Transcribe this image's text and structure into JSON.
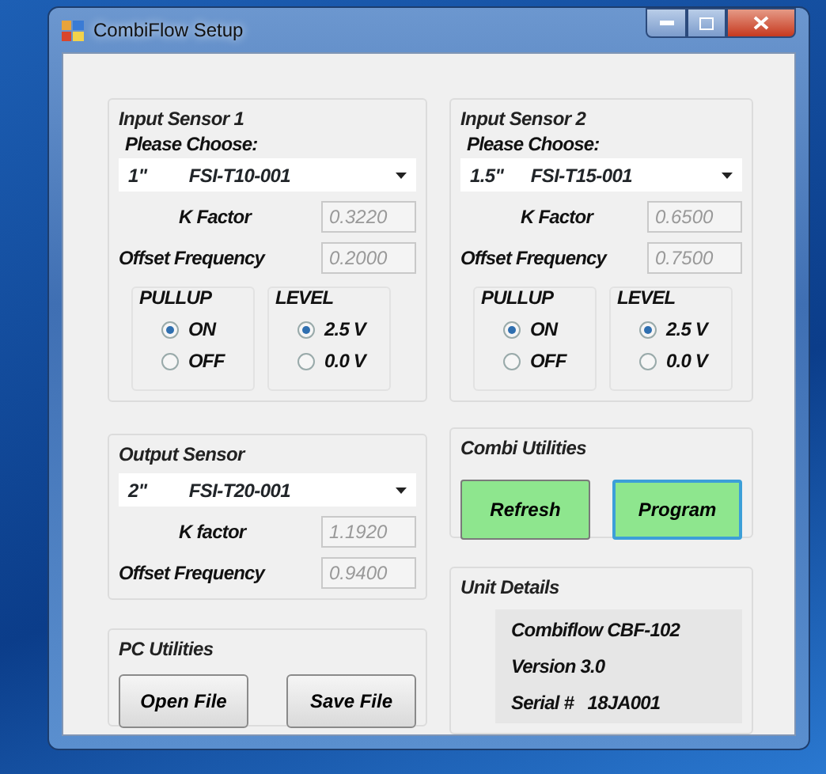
{
  "window": {
    "title": "CombiFlow Setup"
  },
  "input_sensors": [
    {
      "title": "Input Sensor 1",
      "prompt": "Please Choose:",
      "sensor": {
        "size": "1\"",
        "model": "FSI-T10-001"
      },
      "fields": [
        {
          "label": "K Factor",
          "value": "0.3220"
        },
        {
          "label": "Offset Frequency",
          "value": "0.2000"
        }
      ],
      "pullup": {
        "title": "PULLUP",
        "options": [
          {
            "label": "ON",
            "selected": true
          },
          {
            "label": "OFF",
            "selected": false
          }
        ]
      },
      "level": {
        "title": "LEVEL",
        "options": [
          {
            "label": "2.5 V",
            "selected": true
          },
          {
            "label": "0.0 V",
            "selected": false
          }
        ]
      }
    },
    {
      "title": "Input Sensor 2",
      "prompt": "Please Choose:",
      "sensor": {
        "size": "1.5\"",
        "model": "FSI-T15-001"
      },
      "fields": [
        {
          "label": "K Factor",
          "value": "0.6500"
        },
        {
          "label": "Offset Frequency",
          "value": "0.7500"
        }
      ],
      "pullup": {
        "title": "PULLUP",
        "options": [
          {
            "label": "ON",
            "selected": true
          },
          {
            "label": "OFF",
            "selected": false
          }
        ]
      },
      "level": {
        "title": "LEVEL",
        "options": [
          {
            "label": "2.5 V",
            "selected": true
          },
          {
            "label": "0.0 V",
            "selected": false
          }
        ]
      }
    }
  ],
  "output_sensor": {
    "title": "Output Sensor",
    "sensor": {
      "size": "2\"",
      "model": "FSI-T20-001"
    },
    "fields": [
      {
        "label": "K factor",
        "value": "1.1920"
      },
      {
        "label": "Offset Frequency",
        "value": "0.9400"
      }
    ]
  },
  "combi_utilities": {
    "title": "Combi Utilities",
    "buttons": [
      {
        "label": "Refresh",
        "focused": false
      },
      {
        "label": "Program",
        "focused": true
      }
    ]
  },
  "pc_utilities": {
    "title": "PC Utilities",
    "buttons": [
      "Open File",
      "Save File"
    ]
  },
  "unit_details": {
    "title": "Unit Details",
    "lines": [
      "Combiflow CBF-102",
      "Version 3.0",
      "Serial #   18JA001"
    ]
  }
}
